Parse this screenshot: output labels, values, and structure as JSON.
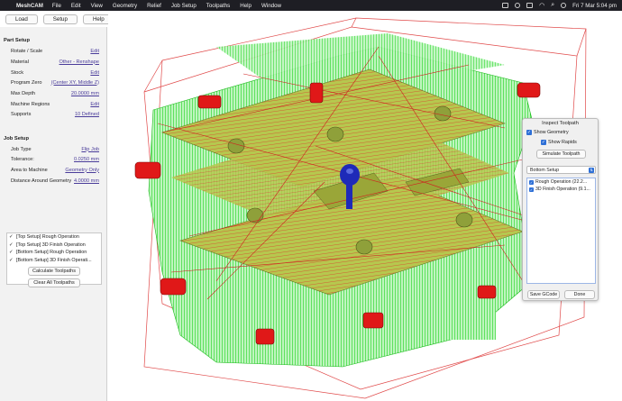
{
  "menubar": {
    "app_name": "MeshCAM",
    "items": [
      "File",
      "Edit",
      "View",
      "Geometry",
      "Relief",
      "Job Setup",
      "Toolpaths",
      "Help",
      "Window"
    ],
    "clock": "Fri 7 Mar  5:04 pm"
  },
  "toolbar": {
    "load_label": "Load",
    "setup_label": "Setup",
    "help_label": "Help"
  },
  "part_setup": {
    "title": "Part Setup",
    "rows": [
      {
        "label": "Rotate / Scale",
        "value": "Edit"
      },
      {
        "label": "Material",
        "value": "Other - Renshape"
      },
      {
        "label": "Stock",
        "value": "Edit"
      },
      {
        "label": "Program Zero",
        "value": "(Center XY, Middle Z)"
      },
      {
        "label": "Max Depth",
        "value": "20.0000 mm"
      },
      {
        "label": "Machine Regions",
        "value": "Edit"
      },
      {
        "label": "Supports",
        "value": "10 Defined"
      }
    ]
  },
  "job_setup": {
    "title": "Job Setup",
    "rows": [
      {
        "label": "Job Type",
        "value": "Flip Job"
      },
      {
        "label": "Tolerance:",
        "value": "0.0250 mm"
      },
      {
        "label": "Area to Machine",
        "value": "Geometry Only"
      },
      {
        "label": "Distance Around Geometry",
        "value": "4.0000 mm"
      }
    ]
  },
  "operations": [
    {
      "check": "✓",
      "label": "[Top Setup]  Rough Operation"
    },
    {
      "check": "✓",
      "label": "[Top Setup]  3D Finish Operation"
    },
    {
      "check": "✓",
      "label": "[Bottom Setup]  Rough Operation"
    },
    {
      "check": "✓",
      "label": "[Bottom Setup]  3D Finish Operati..."
    }
  ],
  "buttons": {
    "calculate": "Calculate Toolpaths",
    "clear": "Clear All Toolpaths"
  },
  "inspect": {
    "title": "Inspect Toolpath",
    "show_geometry": "Show Geometry",
    "show_rapids": "Show Rapids",
    "simulate": "Simulate Toolpath",
    "setup_selected": "Bottom Setup",
    "toolpaths": [
      "Rough Operation (22.2...",
      "3D Finish Operation (9.1..."
    ],
    "save_gcode": "Save GCode",
    "done": "Done"
  },
  "colors": {
    "toolpath_green": "#22e022",
    "cut_red": "#e02020",
    "stock_yellow": "#b8c84a",
    "support_red": "#e01818",
    "tool_blue": "#1e2ab8"
  }
}
